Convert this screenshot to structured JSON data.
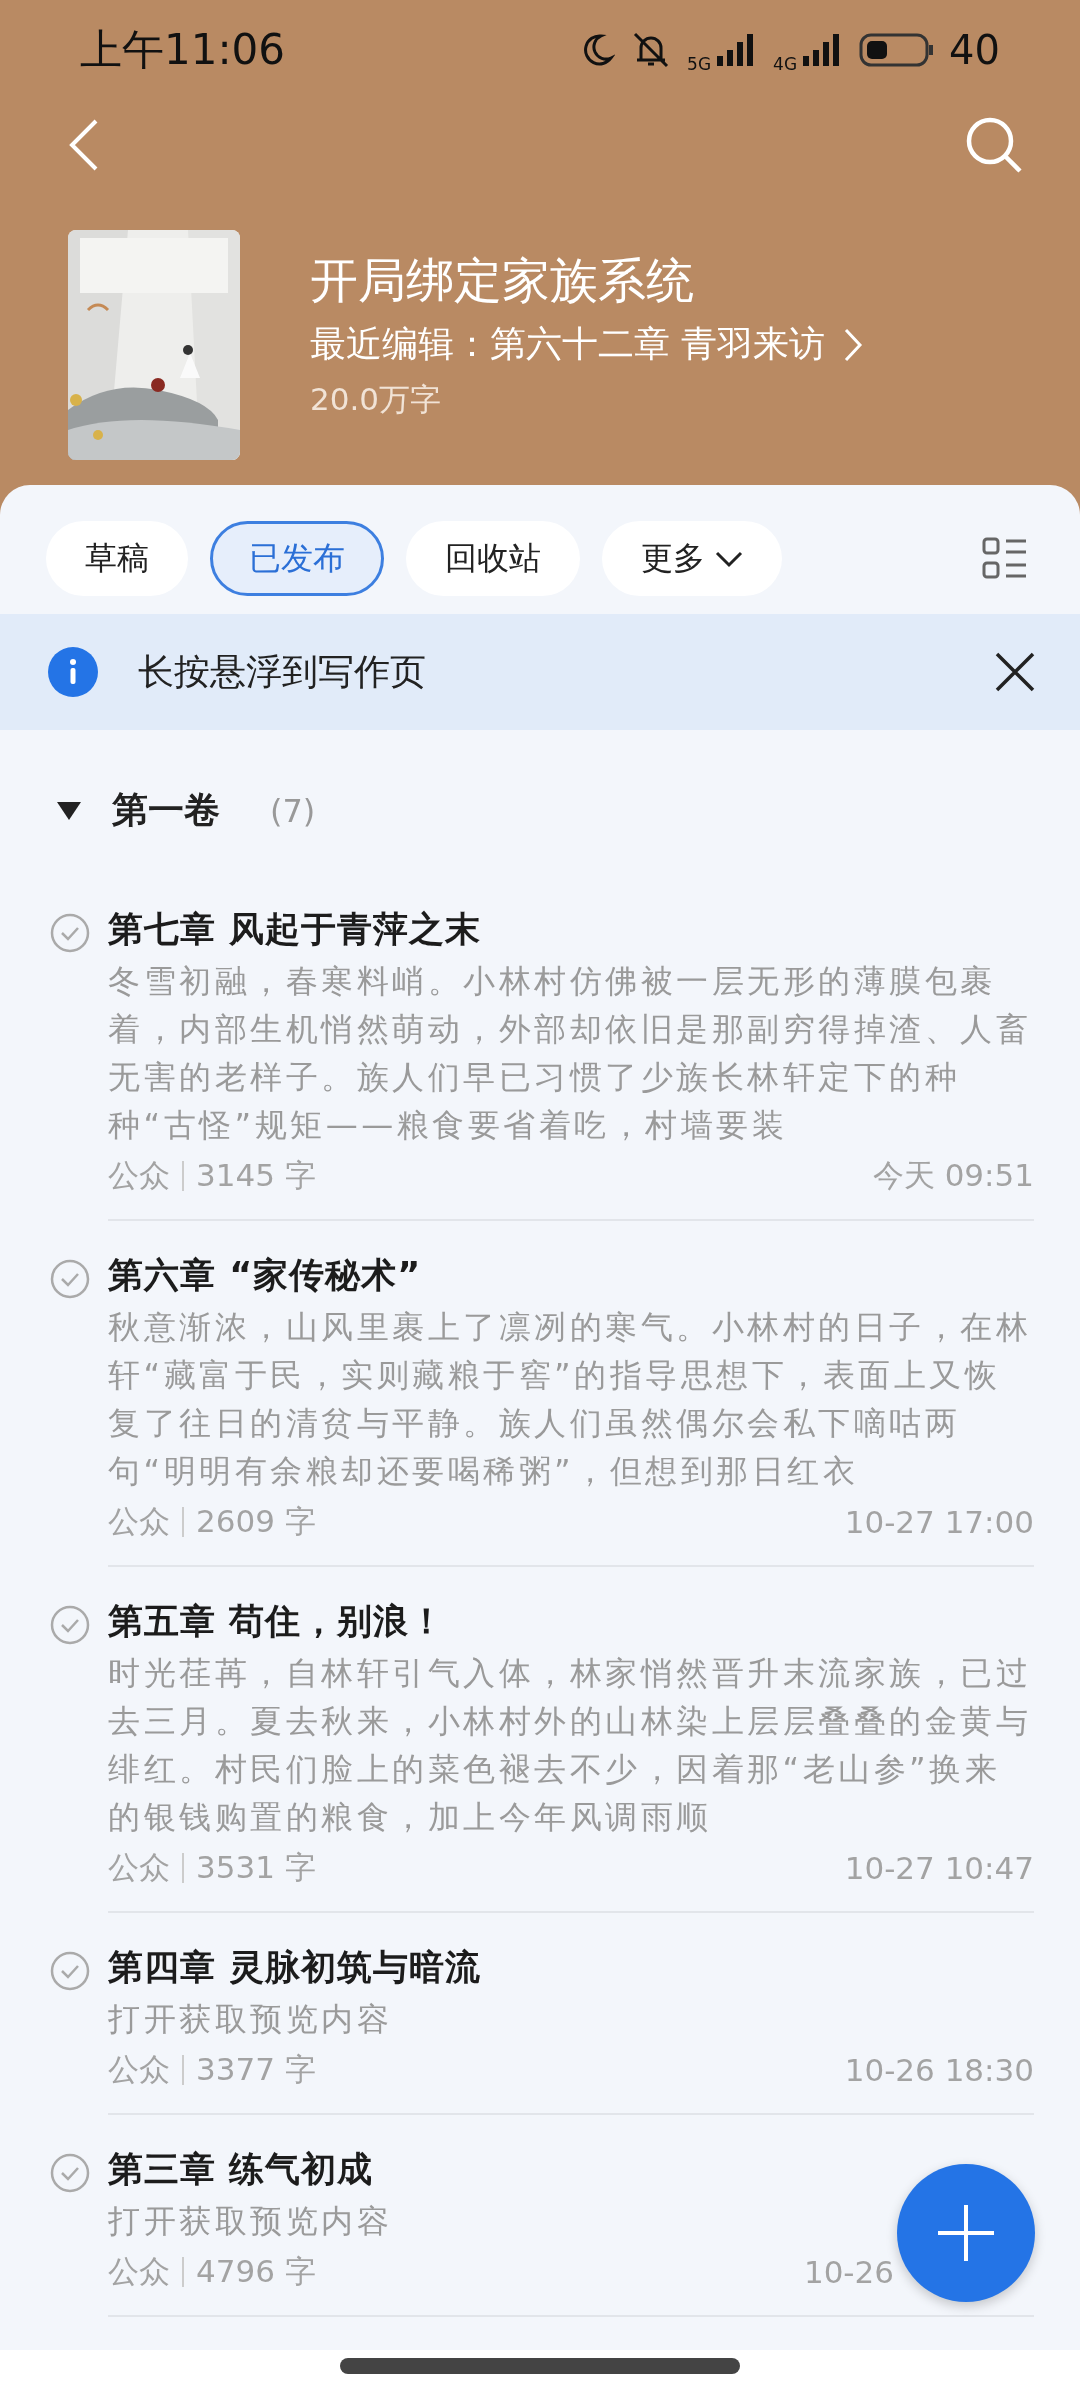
{
  "status_bar": {
    "time": "上午11:06",
    "network_1": "5G",
    "network_2": "4G",
    "battery": "40"
  },
  "book": {
    "title": "开局绑定家族系统",
    "last_edit": "最近编辑：第六十二章 青羽来访",
    "word_count": "20.0万字"
  },
  "tabs": [
    {
      "label": "草稿",
      "selected": false
    },
    {
      "label": "已发布",
      "selected": true
    },
    {
      "label": "回收站",
      "selected": false
    },
    {
      "label": "更多",
      "selected": false,
      "dropdown": true
    }
  ],
  "notice": {
    "text": "长按悬浮到写作页"
  },
  "volume": {
    "title": "第一卷",
    "count": "(7)",
    "expanded": true
  },
  "chapters": [
    {
      "title": "第七章 风起于青萍之末",
      "preview": "冬雪初融，春寒料峭。小林村仿佛被一层无形的薄膜包裹着，内部生机悄然萌动，外部却依旧是那副穷得掉渣、人畜无害的老样子。族人们早已习惯了少族长林轩定下的种种“古怪”规矩——粮食要省着吃，村墙要装",
      "channel": "公众",
      "words": "3145 字",
      "time": "今天 09:51",
      "obscured": false
    },
    {
      "title": "第六章 “家传秘术”",
      "preview": "秋意渐浓，山风里裹上了凛冽的寒气。小林村的日子，在林轩“藏富于民，实则藏粮于窖”的指导思想下，表面上又恢复了往日的清贫与平静。族人们虽然偶尔会私下嘀咕两句“明明有余粮却还要喝稀粥”，但想到那日红衣",
      "channel": "公众",
      "words": "2609 字",
      "time": "10-27 17:00",
      "obscured": false
    },
    {
      "title": "第五章 苟住，别浪！",
      "preview": "时光荏苒，自林轩引气入体，林家悄然晋升末流家族，已过去三月。夏去秋来，小林村外的山林染上层层叠叠的金黄与绯红。村民们脸上的菜色褪去不少，因着那“老山参”换来的银钱购置的粮食，加上今年风调雨顺",
      "channel": "公众",
      "words": "3531 字",
      "time": "10-27 10:47",
      "obscured": false
    },
    {
      "title": "第四章 灵脉初筑与暗流",
      "preview": "打开获取预览内容",
      "channel": "公众",
      "words": "3377 字",
      "time": "10-26 18:30",
      "obscured": false
    },
    {
      "title": "第三章 练气初成",
      "preview": "打开获取预览内容",
      "channel": "公众",
      "words": "4796 字",
      "time": "10-26",
      "obscured": true
    }
  ]
}
